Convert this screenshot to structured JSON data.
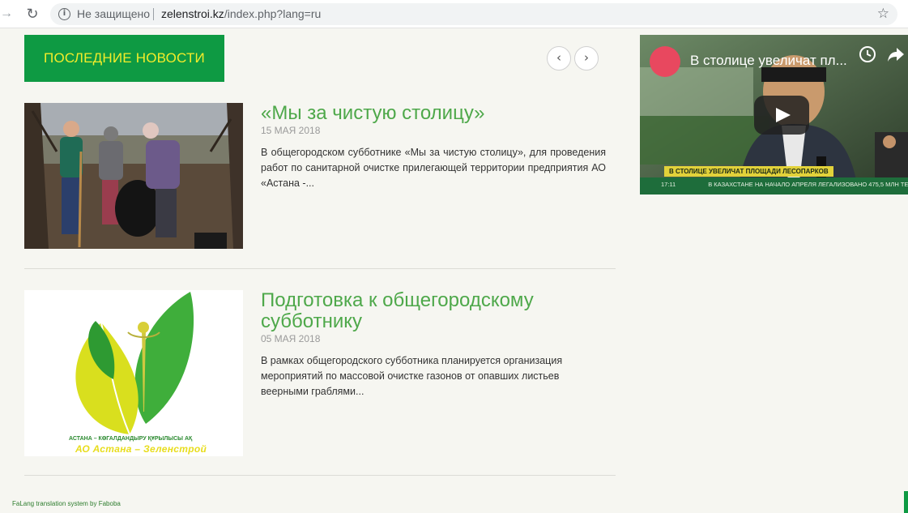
{
  "browser": {
    "security_label": "Не защищено",
    "url_host": "zelenstroi.kz",
    "url_path": "/index.php?lang=ru"
  },
  "news": {
    "heading": "ПОСЛЕДНИЕ НОВОСТИ",
    "prev_label": "‹",
    "next_label": "›",
    "articles": [
      {
        "title": "«Мы за чистую столицу»",
        "date": "15 МАЯ 2018",
        "excerpt": "В общегородском субботнике «Мы за чистую столицу», для проведения работ по санитарной очистке прилегающей территории предприятия АО «Астана -..."
      },
      {
        "title": "Подготовка к общегородскому субботнику",
        "date": "05 МАЯ 2018",
        "excerpt": "В рамках общегородского субботника планируется организация мероприятий по массовой очистке газонов от опавших листьев веерными граблями..."
      }
    ],
    "logo_caption_small": "АСТАНА – КӨГАЛДАНДЫРУ ҚҰРЫЛЫСЫ АҚ",
    "logo_caption_large": "АО Астана – Зеленстрой"
  },
  "video": {
    "title": "В столице увеличат пл...",
    "lower_third": "В СТОЛИЦЕ УВЕЛИЧАТ ПЛОЩАДИ ЛЕСОПАРКОВ",
    "ticker_time": "17:11",
    "ticker_text": "В КАЗАХСТАНЕ НА НАЧАЛО АПРЕЛЯ ЛЕГАЛИЗОВАНО 475,5 МЛН ТЕ"
  },
  "footer": {
    "credit": "FaLang translation system by Faboba"
  },
  "colors": {
    "brand_green": "#0e9a43",
    "heading_yellow": "#f2ec2a",
    "title_green": "#4ea84a",
    "page_bg": "#f6f6f1"
  }
}
